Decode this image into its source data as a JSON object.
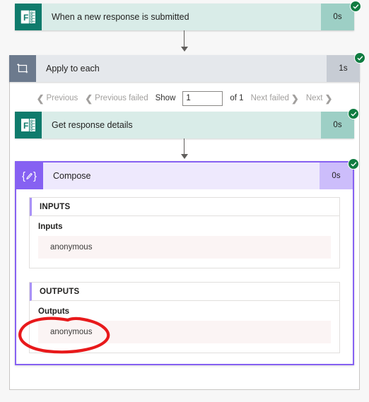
{
  "flow": {
    "steps": [
      {
        "id": "trigger",
        "name": "When a new response is submitted",
        "duration": "0s",
        "icon": "microsoft-forms-icon",
        "status": "succeeded"
      },
      {
        "id": "apply-to-each",
        "name": "Apply to each",
        "duration": "1s",
        "icon": "loop-icon",
        "status": "succeeded"
      },
      {
        "id": "get-response-details",
        "name": "Get response details",
        "duration": "0s",
        "icon": "microsoft-forms-icon",
        "status": "succeeded"
      },
      {
        "id": "compose",
        "name": "Compose",
        "duration": "0s",
        "icon": "compose-braces-icon",
        "status": "succeeded"
      }
    ]
  },
  "pagination": {
    "previous": "Previous",
    "previous_failed": "Previous failed",
    "show_label": "Show",
    "page_value": "1",
    "page_placeholder": "1",
    "of_label": "of 1",
    "next_failed": "Next failed",
    "next": "Next"
  },
  "compose_details": {
    "inputs_section_header": "INPUTS",
    "inputs_label": "Inputs",
    "inputs_value": "anonymous",
    "outputs_section_header": "OUTPUTS",
    "outputs_label": "Outputs",
    "outputs_value": "anonymous"
  },
  "annotation": {
    "type": "hand-drawn-ellipse",
    "color": "#e8191b",
    "targets": "outputs_value"
  },
  "colors": {
    "forms_icon": "#0f7b6c",
    "forms_row": "#d9ece8",
    "forms_duration": "#9dcfc5",
    "loop_icon": "#6c7a8d",
    "loop_row": "#e5e8ec",
    "loop_duration": "#c7ccd4",
    "compose_icon": "#8661f2",
    "compose_row": "#eee9fd",
    "compose_duration": "#ccbdfb",
    "success_badge": "#107c41",
    "value_background": "#fbf4f4",
    "annotation_red": "#e8191b"
  }
}
